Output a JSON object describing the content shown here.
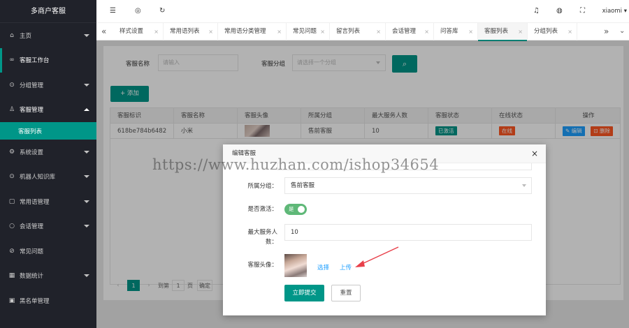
{
  "sidebar": {
    "brand": "多商户客服",
    "items": [
      {
        "label": "主页",
        "icon": "home-icon",
        "glyph": "⌂",
        "caret": "down"
      },
      {
        "label": "客服工作台",
        "icon": "chat-icon",
        "glyph": "∞",
        "caret": "none"
      },
      {
        "label": "分组管理",
        "icon": "group-icon",
        "glyph": "⊙",
        "caret": "down"
      },
      {
        "label": "客服管理",
        "icon": "user-icon",
        "glyph": "♙",
        "caret": "up"
      },
      {
        "label": "客服列表",
        "sub": true
      },
      {
        "label": "系统设置",
        "icon": "gear-icon",
        "glyph": "⚙",
        "caret": "down"
      },
      {
        "label": "机器人知识库",
        "icon": "robot-icon",
        "glyph": "⊙",
        "caret": "down"
      },
      {
        "label": "常用语管理",
        "icon": "phrase-icon",
        "glyph": "▢",
        "caret": "down"
      },
      {
        "label": "会话管理",
        "icon": "session-icon",
        "glyph": "○",
        "caret": "down"
      },
      {
        "label": "常见问题",
        "icon": "question-icon",
        "glyph": "⊘",
        "caret": "none"
      },
      {
        "label": "数据统计",
        "icon": "stats-icon",
        "glyph": "▦",
        "caret": "down"
      },
      {
        "label": "黑名单管理",
        "icon": "blacklist-icon",
        "glyph": "▣",
        "caret": "none"
      }
    ]
  },
  "topbar": {
    "username": "xiaomi",
    "icons": [
      "menu-toggle-icon",
      "globe-icon",
      "refresh-icon",
      "bell-icon",
      "theme-icon",
      "fullscreen-icon"
    ]
  },
  "tabs": [
    {
      "label": "样式设置"
    },
    {
      "label": "常用语列表"
    },
    {
      "label": "常用语分类管理"
    },
    {
      "label": "常见问题"
    },
    {
      "label": "留言列表"
    },
    {
      "label": "会话管理"
    },
    {
      "label": "问答库"
    },
    {
      "label": "客服列表",
      "active": true
    },
    {
      "label": "分组列表"
    }
  ],
  "search": {
    "name_label": "客服名称",
    "name_placeholder": "请输入",
    "group_label": "客服分组",
    "group_placeholder": "请选择一个分组",
    "search_icon": "search-icon"
  },
  "add_button": "+ 添加",
  "table": {
    "headers": [
      "客服标识",
      "客服名称",
      "客服头像",
      "所属分组",
      "最大服务人数",
      "客服状态",
      "在线状态",
      "操作"
    ],
    "rows": [
      {
        "id": "618be784b6482",
        "name": "小米",
        "group": "售前客服",
        "max": "10",
        "status": "已激活",
        "online": "在线",
        "edit": "✎ 编辑",
        "delete": "⊡ 删除"
      }
    ]
  },
  "pager": {
    "current": "1",
    "goto_label": "到第",
    "page_value": "1",
    "page_unit": "页",
    "confirm": "确定"
  },
  "modal": {
    "title": "编辑客服",
    "group_label": "所属分组：",
    "group_value": "售前客服",
    "active_label": "是否激活：",
    "switch_text": "是",
    "max_label": "最大服务人数：",
    "max_value": "10",
    "avatar_label": "客服头像：",
    "select_link": "选择",
    "upload_link": "上传",
    "submit": "立即提交",
    "reset": "重置"
  },
  "watermark": "https://www.huzhan.com/ishop34654",
  "colors": {
    "accent": "#009688",
    "danger": "#ff5722",
    "link": "#1e9fff",
    "switch_on": "#5fb878",
    "annotation_arrow": "#e8404a"
  }
}
